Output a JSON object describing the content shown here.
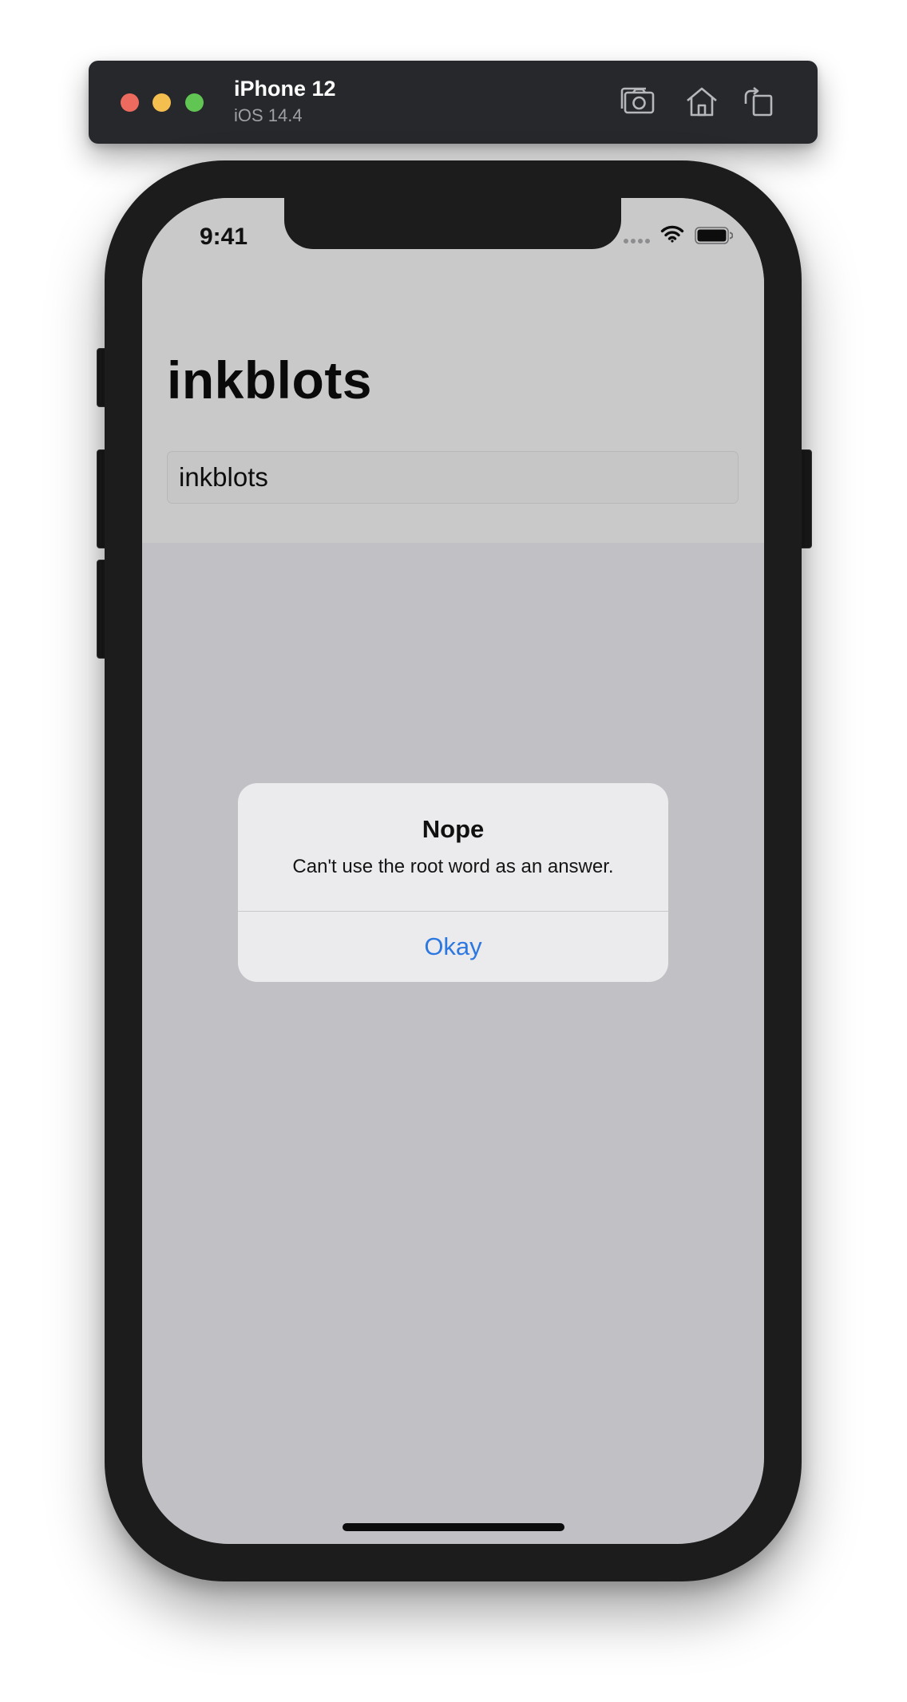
{
  "simulator": {
    "device_name": "iPhone 12",
    "os_version": "iOS 14.4",
    "icons": [
      "screenshot-icon",
      "home-icon",
      "rotate-icon"
    ]
  },
  "status_bar": {
    "time": "9:41",
    "icons": [
      "cellular-signal-icon",
      "wifi-icon",
      "battery-icon"
    ]
  },
  "screen": {
    "title": "inkblots",
    "root_word_field_value": "inkblots"
  },
  "alert": {
    "title": "Nope",
    "message": "Can't use the root word as an answer.",
    "button_label": "Okay"
  },
  "colors": {
    "alert_button": "#2c77e0",
    "traffic_red": "#ed6a5e",
    "traffic_yellow": "#f5bf4f",
    "traffic_green": "#61c554"
  }
}
